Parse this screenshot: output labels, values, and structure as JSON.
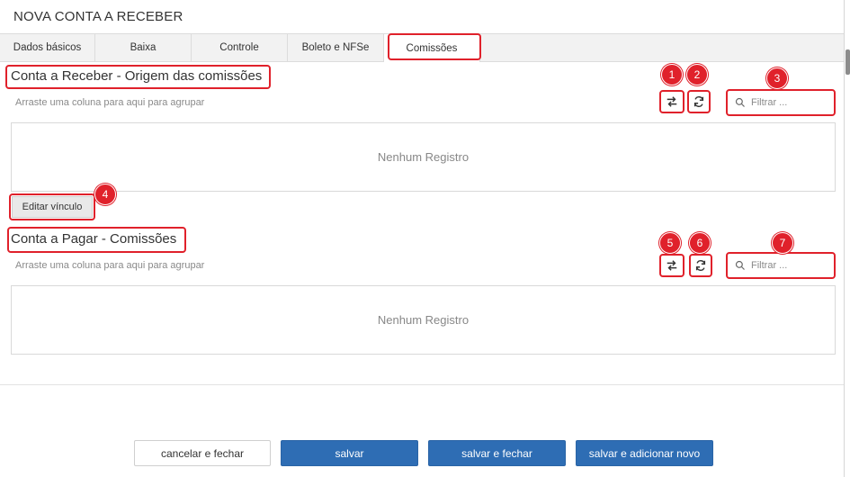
{
  "window": {
    "title": "NOVA CONTA A RECEBER"
  },
  "tabs": [
    {
      "label": "Dados básicos"
    },
    {
      "label": "Baixa"
    },
    {
      "label": "Controle"
    },
    {
      "label": "Boleto e NFSe"
    },
    {
      "label": "Comissões"
    }
  ],
  "section1": {
    "title": "Conta a Receber - Origem das comissões",
    "group_hint": "Arraste uma coluna para aqui para agrupar",
    "filter_placeholder": "Filtrar ...",
    "empty_text": "Nenhum Registro",
    "edit_button": "Editar vínculo"
  },
  "section2": {
    "title": "Conta a Pagar - Comissões",
    "group_hint": "Arraste uma coluna para aqui para agrupar",
    "filter_placeholder": "Filtrar ...",
    "empty_text": "Nenhum Registro"
  },
  "badges": [
    "1",
    "2",
    "3",
    "4",
    "5",
    "6",
    "7"
  ],
  "footer": {
    "cancel": "cancelar e fechar",
    "save": "salvar",
    "save_close": "salvar e fechar",
    "save_new": "salvar e adicionar novo"
  },
  "icons": {
    "swap": "swap-arrows-icon",
    "refresh": "refresh-icon",
    "search": "search-icon"
  },
  "colors": {
    "annotation_red": "#e0212b",
    "primary_button": "#2e6db4"
  }
}
